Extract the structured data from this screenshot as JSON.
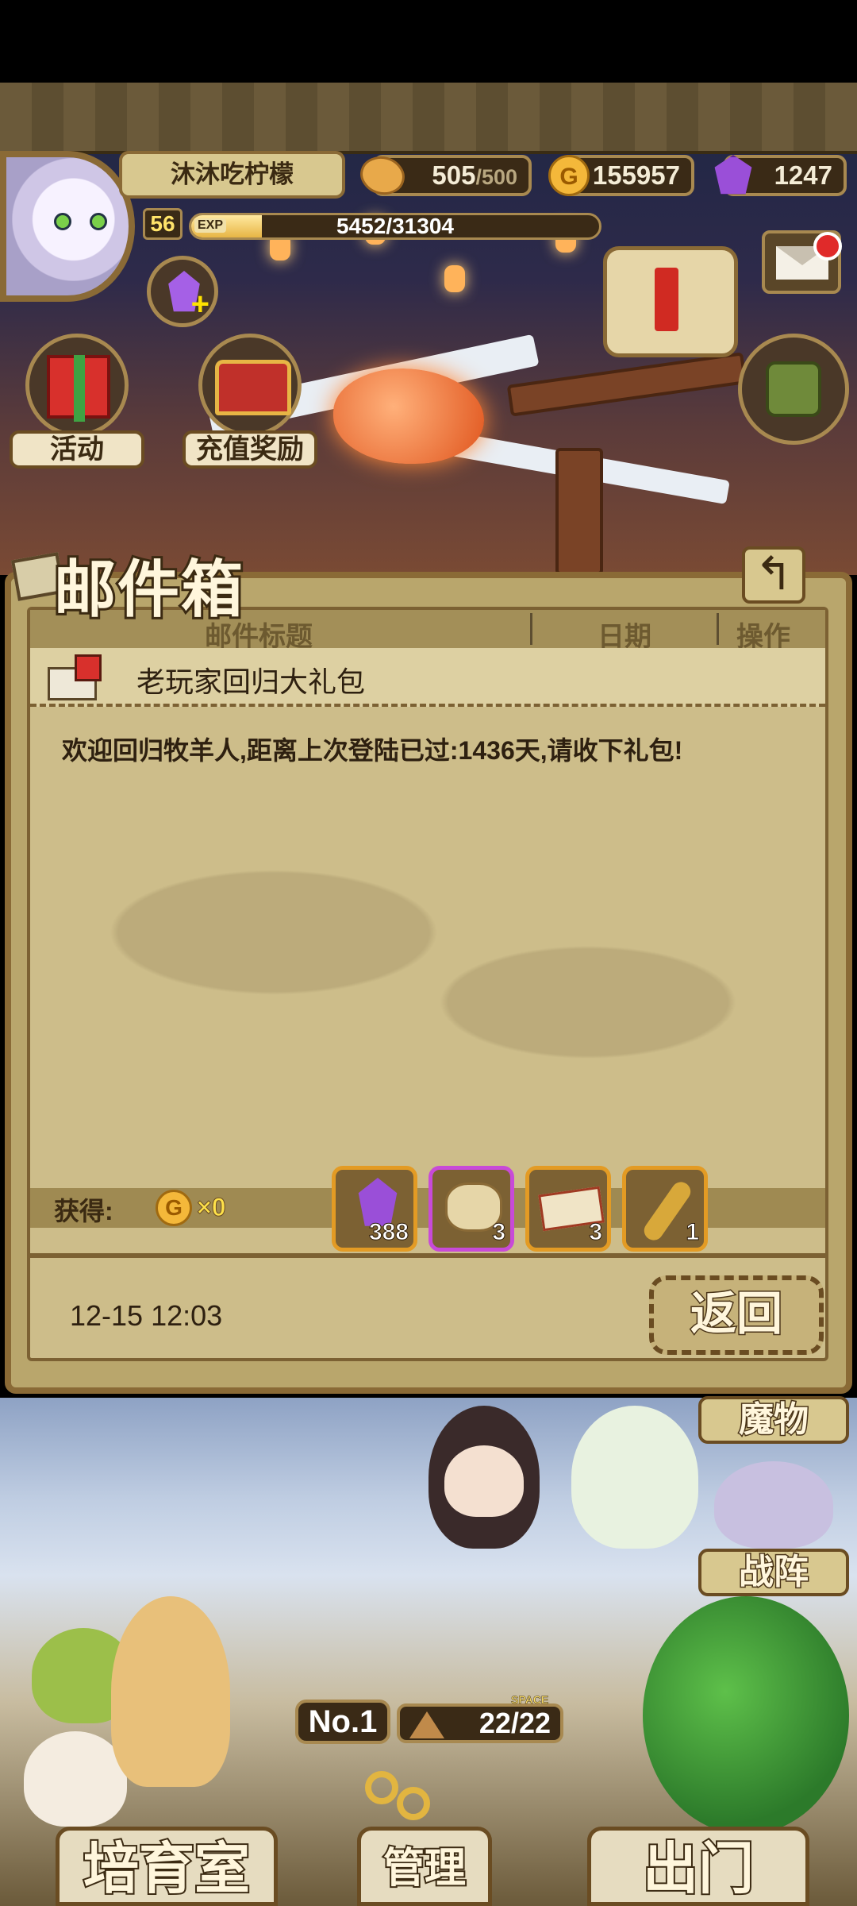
{
  "player": {
    "name": "沐沐吃柠檬",
    "level": "56",
    "exp_tag": "EXP",
    "exp_text": "5452/31304",
    "exp_fraction": 0.174
  },
  "resources": {
    "stamina_current": "505",
    "stamina_max": "/500",
    "gold": "155957",
    "gems": "1247",
    "coin_symbol": "G"
  },
  "top_buttons": {
    "activity_label": "活动",
    "recharge_label": "充值奖励"
  },
  "mailbox": {
    "title": "邮件箱",
    "back_arrow": "↰",
    "columns": {
      "subject": "邮件标题",
      "date": "日期",
      "action": "操作"
    },
    "mail": {
      "subject": "老玩家回归大礼包",
      "body": "欢迎回归牧羊人,距离上次登陆已过:1436天,请收下礼包!",
      "date": "12-15 12:03"
    },
    "rewards_label": "获得:",
    "gold_reward": "×0",
    "items": [
      {
        "icon": "purple-gem-icon",
        "count": "388"
      },
      {
        "icon": "treasure-sack-icon",
        "count": "3"
      },
      {
        "icon": "ticket-icon",
        "count": "3"
      },
      {
        "icon": "golden-key-icon",
        "count": "1"
      }
    ],
    "return_label": "返回"
  },
  "bottom": {
    "monster_tab": "魔物",
    "formation_tab": "战阵",
    "rank_prefix": "No.",
    "rank": "1",
    "space_label": "SPACE",
    "space_value": "22/22",
    "nursery_label": "培育室",
    "manage_label": "管理",
    "depart_label": "出门"
  },
  "colors": {
    "panel": "#cdbd8a",
    "frame": "#8a6a36",
    "accent_orange": "#e39b24",
    "notification_red": "#e02a2a"
  }
}
